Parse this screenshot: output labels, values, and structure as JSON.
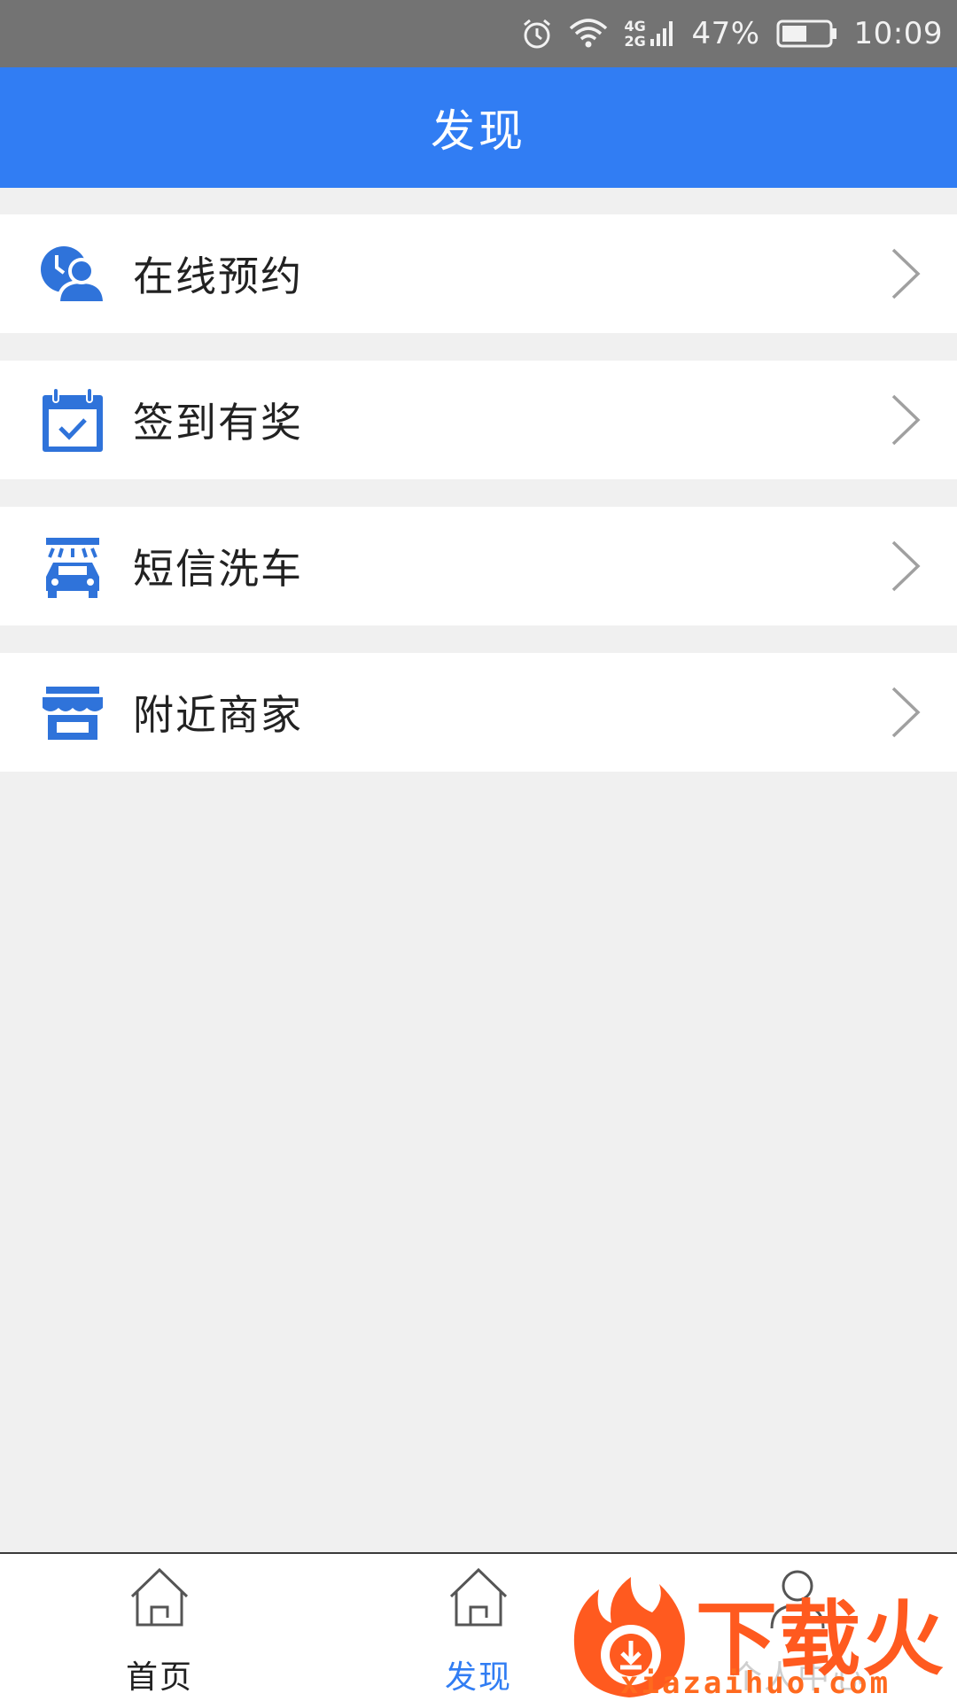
{
  "status_bar": {
    "network_label": "4G 2G",
    "battery": "47%",
    "time": "10:09",
    "icons": [
      "alarm-icon",
      "wifi-icon",
      "cell-signal-icon",
      "battery-icon"
    ]
  },
  "header": {
    "title": "发现"
  },
  "menu": {
    "items": [
      {
        "label": "在线预约",
        "icon": "appointment-person-icon"
      },
      {
        "label": "签到有奖",
        "icon": "calendar-check-icon"
      },
      {
        "label": "短信洗车",
        "icon": "car-wash-icon"
      },
      {
        "label": "附近商家",
        "icon": "store-icon"
      }
    ]
  },
  "bottom_nav": {
    "tabs": [
      {
        "label": "首页",
        "icon": "home-icon",
        "active": false
      },
      {
        "label": "发现",
        "icon": "home-icon",
        "active": true
      },
      {
        "label": "个人中心",
        "icon": "person-icon",
        "active": false
      }
    ]
  },
  "watermark": {
    "brand": "下载火",
    "url": "xiazaihuo.com"
  },
  "colors": {
    "accent": "#317df3",
    "status_bar": "#737373",
    "background": "#f0f0f0",
    "watermark": "#ff5a1f"
  }
}
